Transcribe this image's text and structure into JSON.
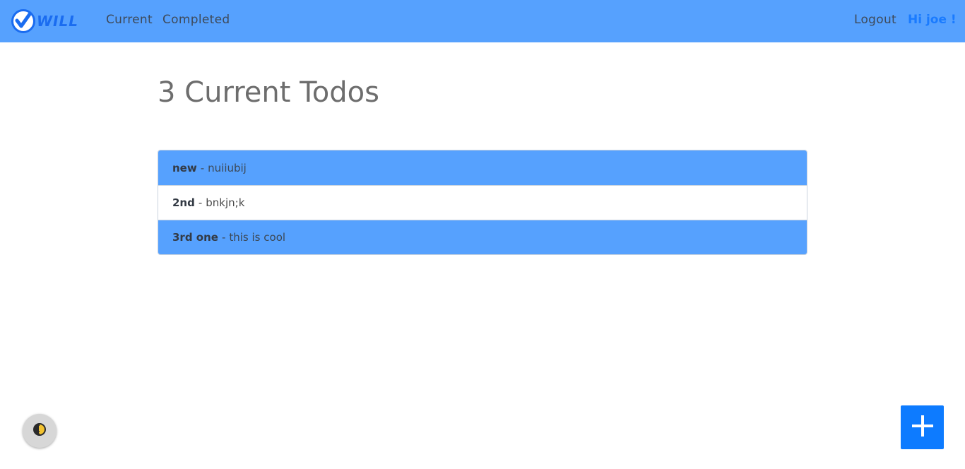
{
  "navbar": {
    "brand_text": "WILL",
    "links": {
      "current": "Current",
      "completed": "Completed",
      "logout": "Logout"
    },
    "greeting": "Hi joe !"
  },
  "main": {
    "title": "3 Current Todos",
    "todos": [
      {
        "title": "new",
        "separator": "-",
        "description": "nuiiubij",
        "highlighted": true
      },
      {
        "title": "2nd",
        "separator": "-",
        "description": "bnkjn;k",
        "highlighted": false
      },
      {
        "title": "3rd one",
        "separator": "-",
        "description": "this is cool",
        "highlighted": true
      }
    ]
  },
  "icons": {
    "brand": "check-mark-icon",
    "help": "help-bubble-icon",
    "add": "plus-icon"
  },
  "colors": {
    "navbar_bg": "#56a1fe",
    "accent": "#0d7bff",
    "greeting": "#1a7bff",
    "highlight_row": "#56a1fe"
  }
}
